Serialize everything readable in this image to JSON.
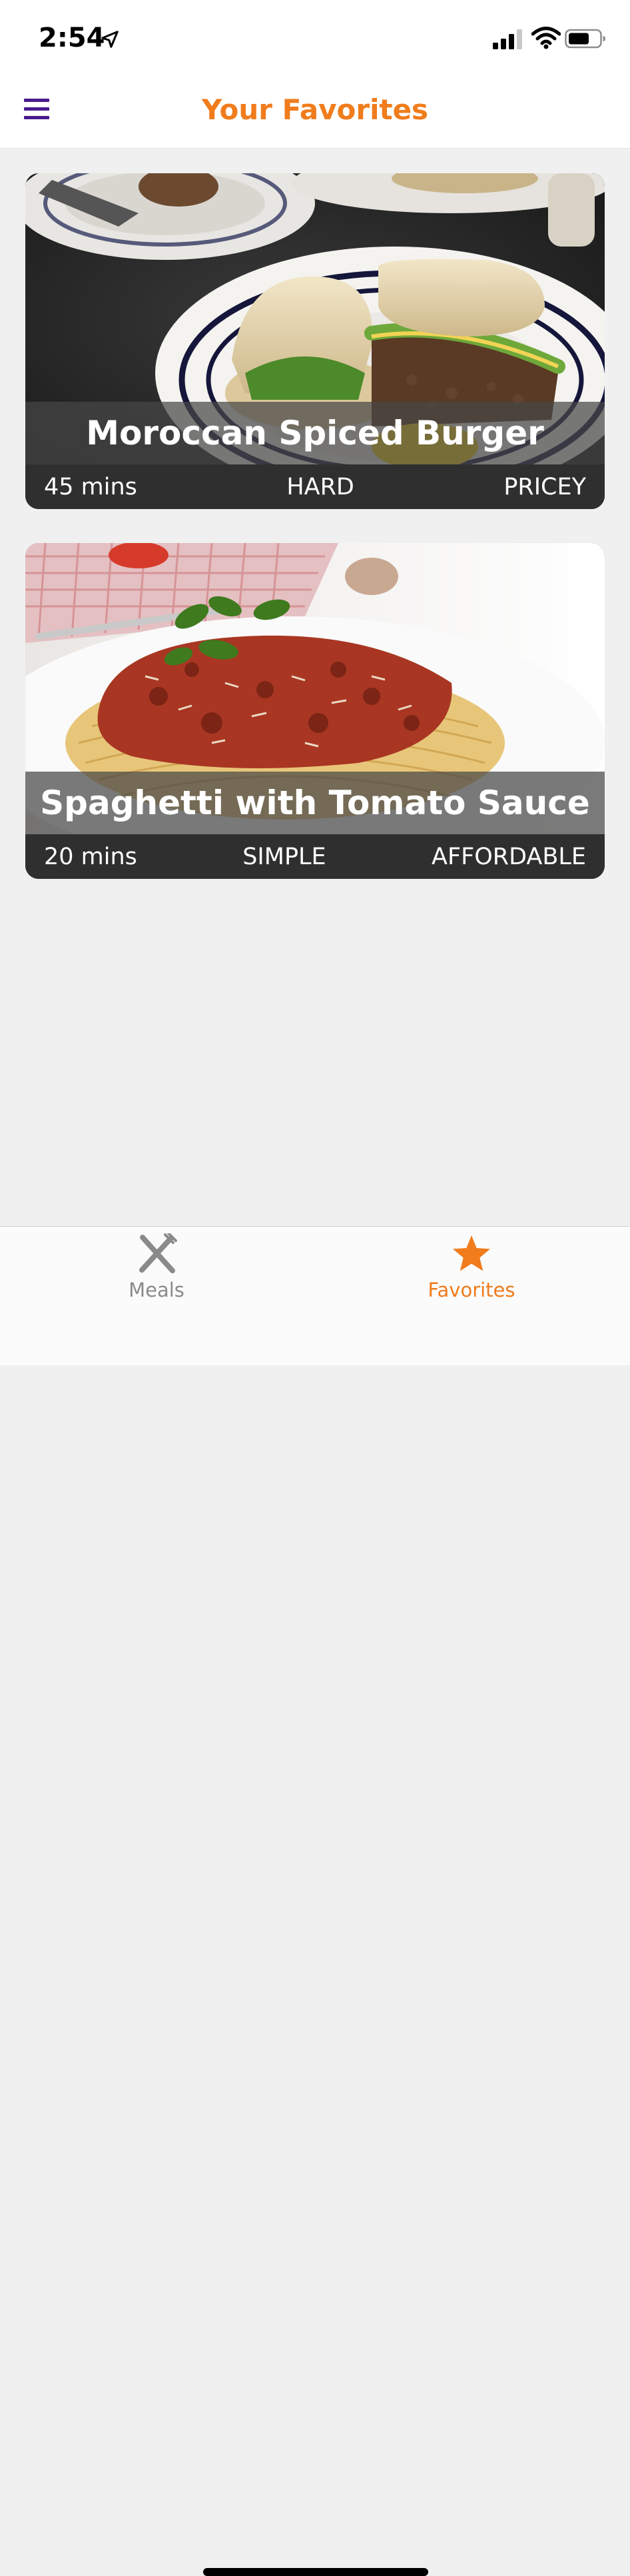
{
  "status_bar": {
    "time": "2:54"
  },
  "header": {
    "title": "Your Favorites"
  },
  "meals": [
    {
      "title": "Moroccan Spiced Burger",
      "duration": "45 mins",
      "complexity": "HARD",
      "affordability": "PRICEY",
      "image": "burger-photo"
    },
    {
      "title": "Spaghetti with Tomato Sauce",
      "duration": "20 mins",
      "complexity": "SIMPLE",
      "affordability": "AFFORDABLE",
      "image": "spaghetti-photo"
    }
  ],
  "tabs": {
    "meals": {
      "label": "Meals",
      "icon": "utensils-icon"
    },
    "favorites": {
      "label": "Favorites",
      "icon": "star-icon",
      "active": true
    }
  },
  "colors": {
    "accent": "#f07c1c",
    "menu_icon": "#4a1a8c",
    "card_details_bg": "#2f2f2f",
    "background": "#f0f0f0"
  }
}
